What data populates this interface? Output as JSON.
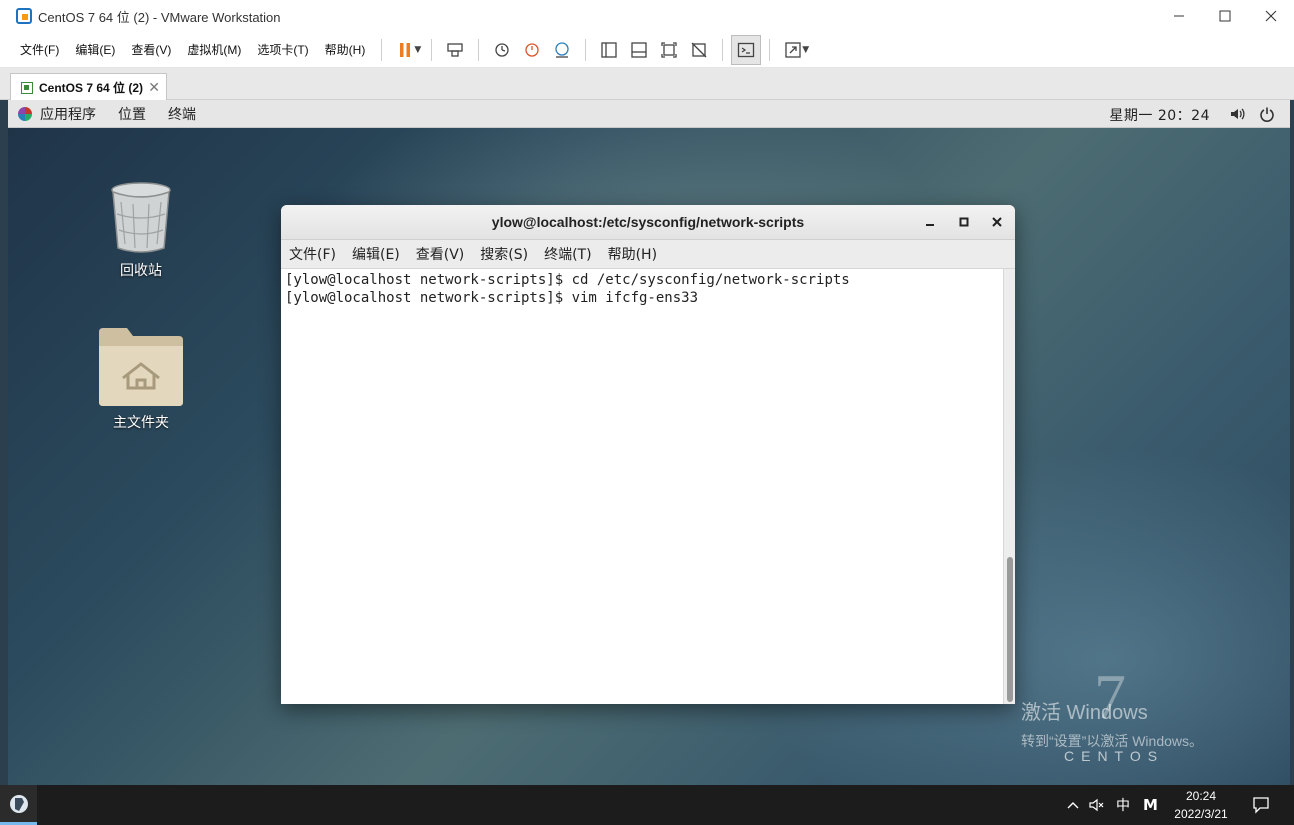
{
  "window": {
    "title": "CentOS 7 64 位 (2) - VMware Workstation",
    "controls": [
      "minimize",
      "maximize",
      "close"
    ]
  },
  "menubar": {
    "items": [
      "文件(F)",
      "编辑(E)",
      "查看(V)",
      "虚拟机(M)",
      "选项卡(T)",
      "帮助(H)"
    ]
  },
  "toolbar": {
    "icons": [
      "pause-icon",
      "send-ctrl-alt-del-icon",
      "snapshot-icon",
      "revert-snapshot-icon",
      "snapshot-manager-icon",
      "show-library-icon",
      "thumbnail-bar-icon",
      "fit-guest-icon",
      "unity-icon",
      "console-view-icon",
      "full-screen-icon"
    ]
  },
  "vm_tab": {
    "label": "CentOS 7 64 位 (2)"
  },
  "gnome": {
    "menus": [
      "应用程序",
      "位置",
      "终端"
    ],
    "clock": "星期一 20：24"
  },
  "desktop": {
    "icons": [
      {
        "label": "回收站"
      },
      {
        "label": "主文件夹"
      }
    ]
  },
  "terminal": {
    "title": "ylow@localhost:/etc/sysconfig/network-scripts",
    "menus": [
      "文件(F)",
      "编辑(E)",
      "查看(V)",
      "搜索(S)",
      "终端(T)",
      "帮助(H)"
    ],
    "lines": [
      "[ylow@localhost network-scripts]$ cd /etc/sysconfig/network-scripts",
      "[ylow@localhost network-scripts]$ vim ifcfg-ens33"
    ]
  },
  "watermark": {
    "activate_title": "激活 Windows",
    "activate_sub": "转到“设置”以激活 Windows。",
    "centos": "CENTOS",
    "seven": "7"
  },
  "taskbar": {
    "ime": "中",
    "ime2": "M",
    "time": "20:24",
    "date": "2022/3/21"
  },
  "colors": {
    "pause_accent": "#f07c1e",
    "titlebar_bg": "#ffffff",
    "taskbar_bg": "#1c1c1c"
  }
}
